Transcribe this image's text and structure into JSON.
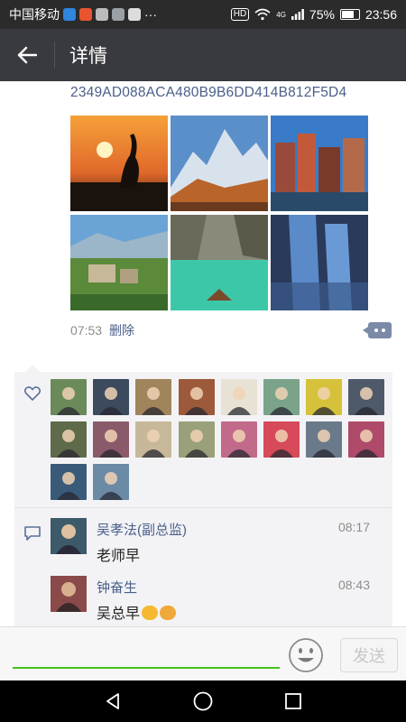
{
  "status_bar": {
    "carrier": "中国移动",
    "network": "4G",
    "battery_percent": "75%",
    "battery_level": 0.75,
    "time": "23:56",
    "more": "···"
  },
  "nav": {
    "title": "详情"
  },
  "post": {
    "text": "2349AD088ACA480B9B6DD414B812F5D4",
    "time": "07:53",
    "delete_label": "删除",
    "photos": [
      "crane-sunset-photo",
      "snowy-mountain-photo",
      "canal-houses-photo",
      "alpine-village-photo",
      "lake-boat-photo",
      "waterfall-photo"
    ]
  },
  "likes": {
    "avatar_colors": [
      "#6b8a5a",
      "#3c4a5e",
      "#a0845c",
      "#9c5a3a",
      "#e8e2d4",
      "#7aa38a",
      "#d6c23a",
      "#4e5a6a",
      "#5e6a4a",
      "#8a5a6a",
      "#c8b89a",
      "#9aa07a",
      "#c26a8a",
      "#d64a5a",
      "#6a7a8a",
      "#b04a6a",
      "#3a5a7a",
      "#6a8aa6"
    ]
  },
  "comments": [
    {
      "name": "吴孝法(副总监)",
      "time": "08:17",
      "text": "老师早",
      "avatar_color": "#3c5a6a"
    },
    {
      "name": "钟奋生",
      "time": "08:43",
      "text": "吴总早",
      "avatar_color": "#8a4a4a"
    }
  ],
  "input": {
    "placeholder": "",
    "send_label": "发送"
  },
  "colors": {
    "nav_bg": "#393a3f",
    "link_blue": "#4a5f8a",
    "accent_green": "#45c01a"
  }
}
